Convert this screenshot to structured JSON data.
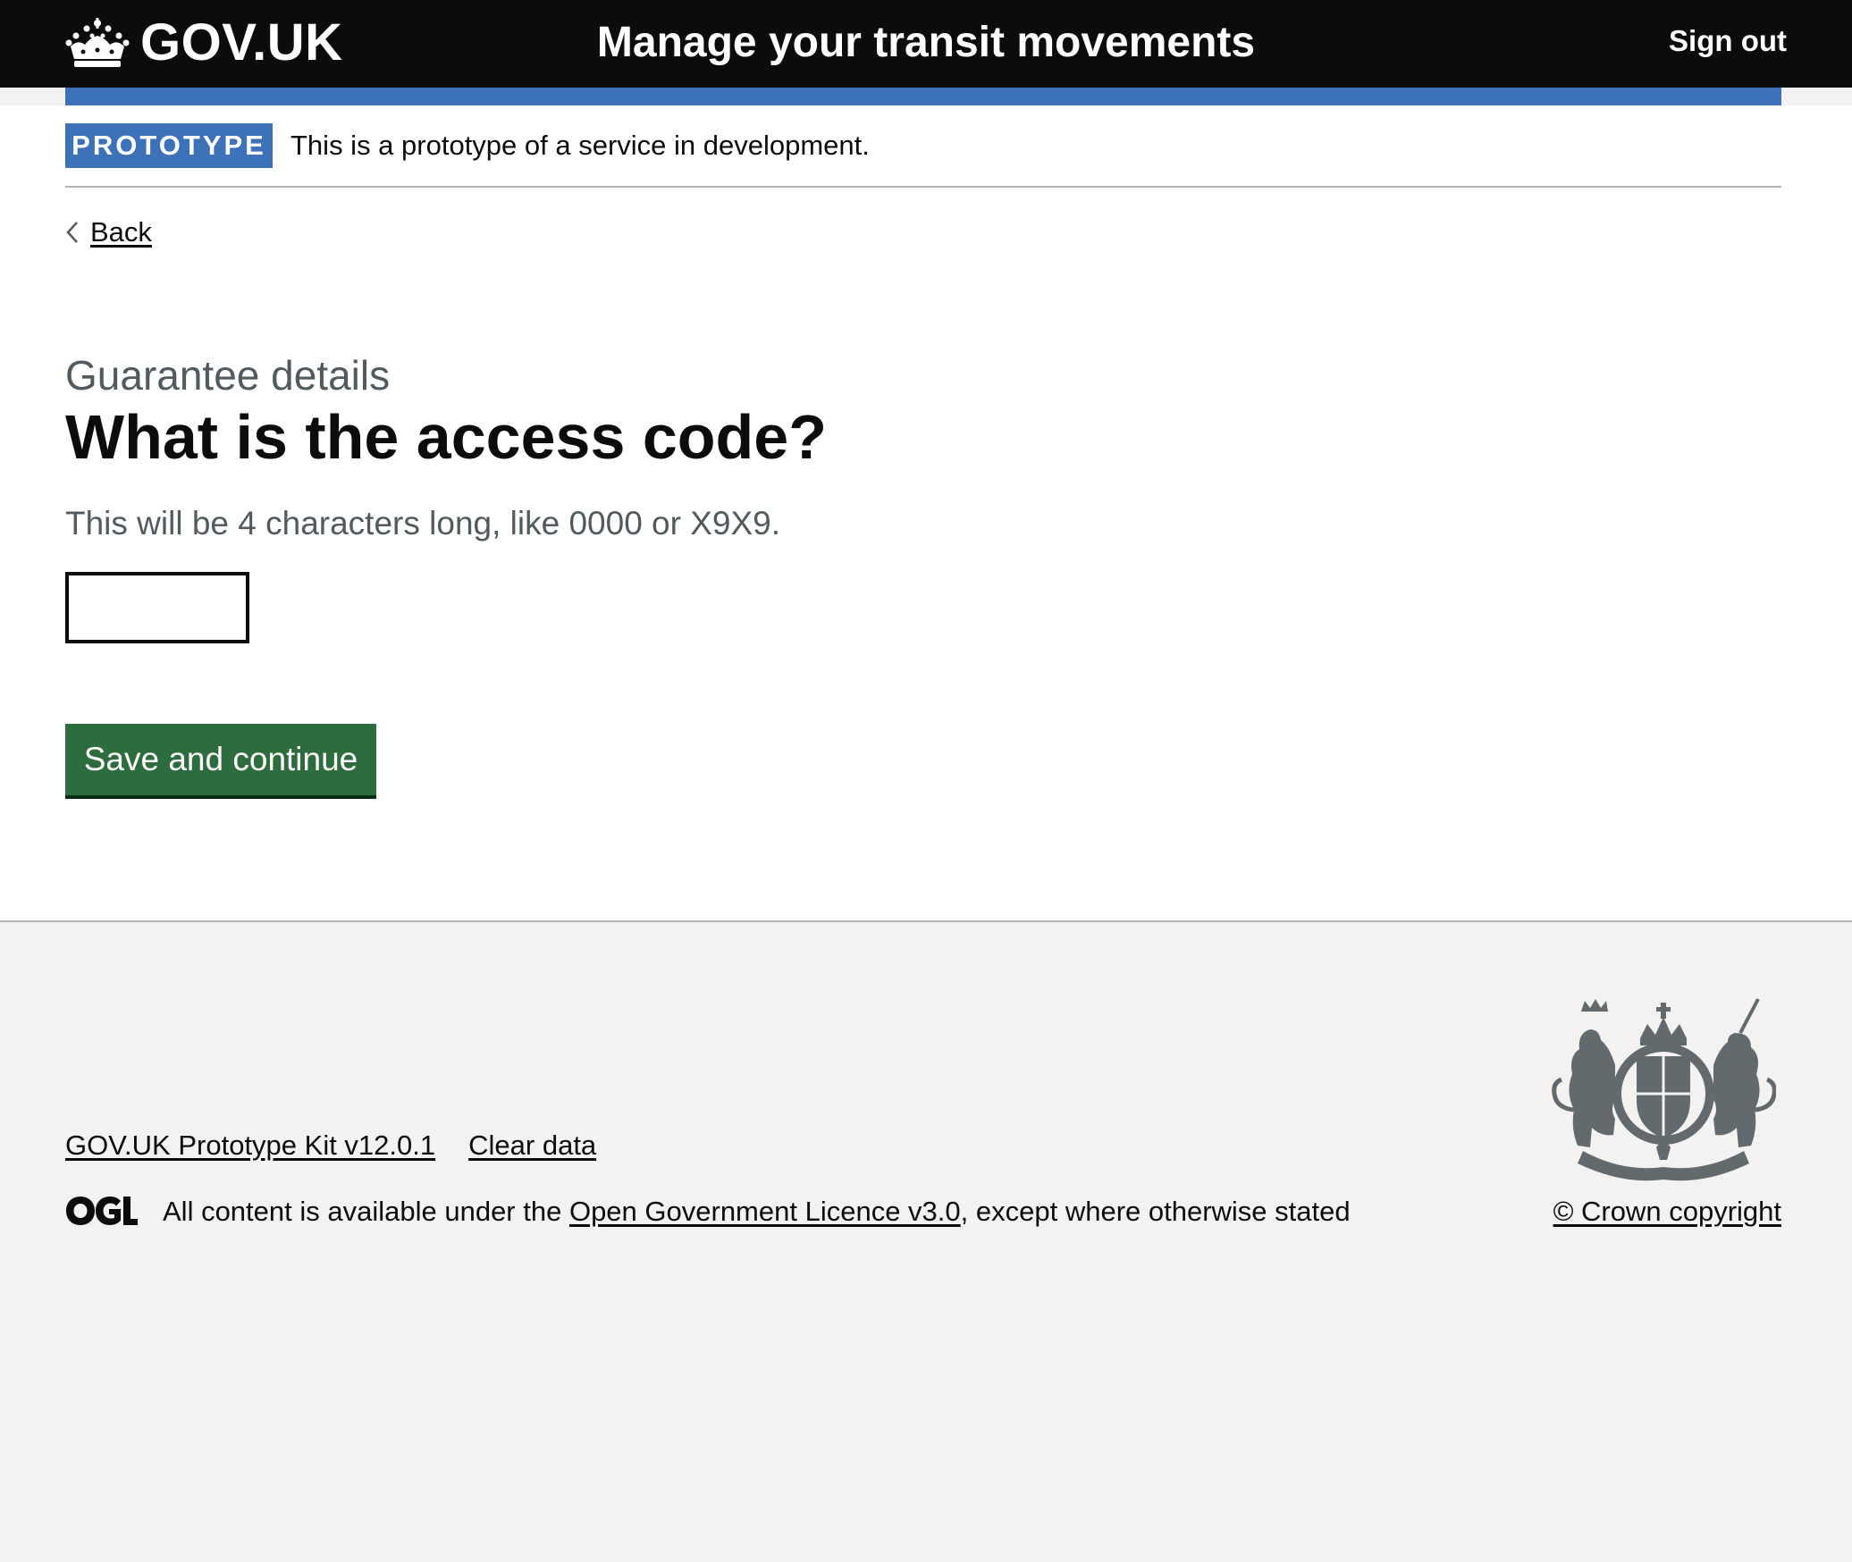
{
  "header": {
    "logo_text": "GOV.UK",
    "logo_icon": "crown-icon",
    "service_name": "Manage your transit movements",
    "sign_out_label": "Sign out"
  },
  "phase_banner": {
    "tag": "PROTOTYPE",
    "text": "This is a prototype of a service in development."
  },
  "back_link": {
    "label": "Back",
    "icon": "chevron-left-icon"
  },
  "main": {
    "caption": "Guarantee details",
    "title": "What is the access code?",
    "hint": "This will be 4 characters long, like 0000 or X9X9.",
    "input_value": "",
    "button_label": "Save and continue"
  },
  "footer": {
    "links": [
      "GOV.UK Prototype Kit v12.0.1",
      "Clear data"
    ],
    "licence_prefix": "All content is available under the ",
    "licence_link": "Open Government Licence v3.0",
    "licence_suffix": ", except where otherwise stated",
    "copyright": "© Crown copyright",
    "ogl_icon": "ogl-logo-icon",
    "crest_icon": "royal-coat-of-arms-icon"
  },
  "colors": {
    "header_bg": "#0b0c0c",
    "brand_blue": "#3d71b8",
    "button_green": "#2d6c3c",
    "secondary_text": "#505a5f",
    "footer_bg": "#f3f2f1"
  }
}
